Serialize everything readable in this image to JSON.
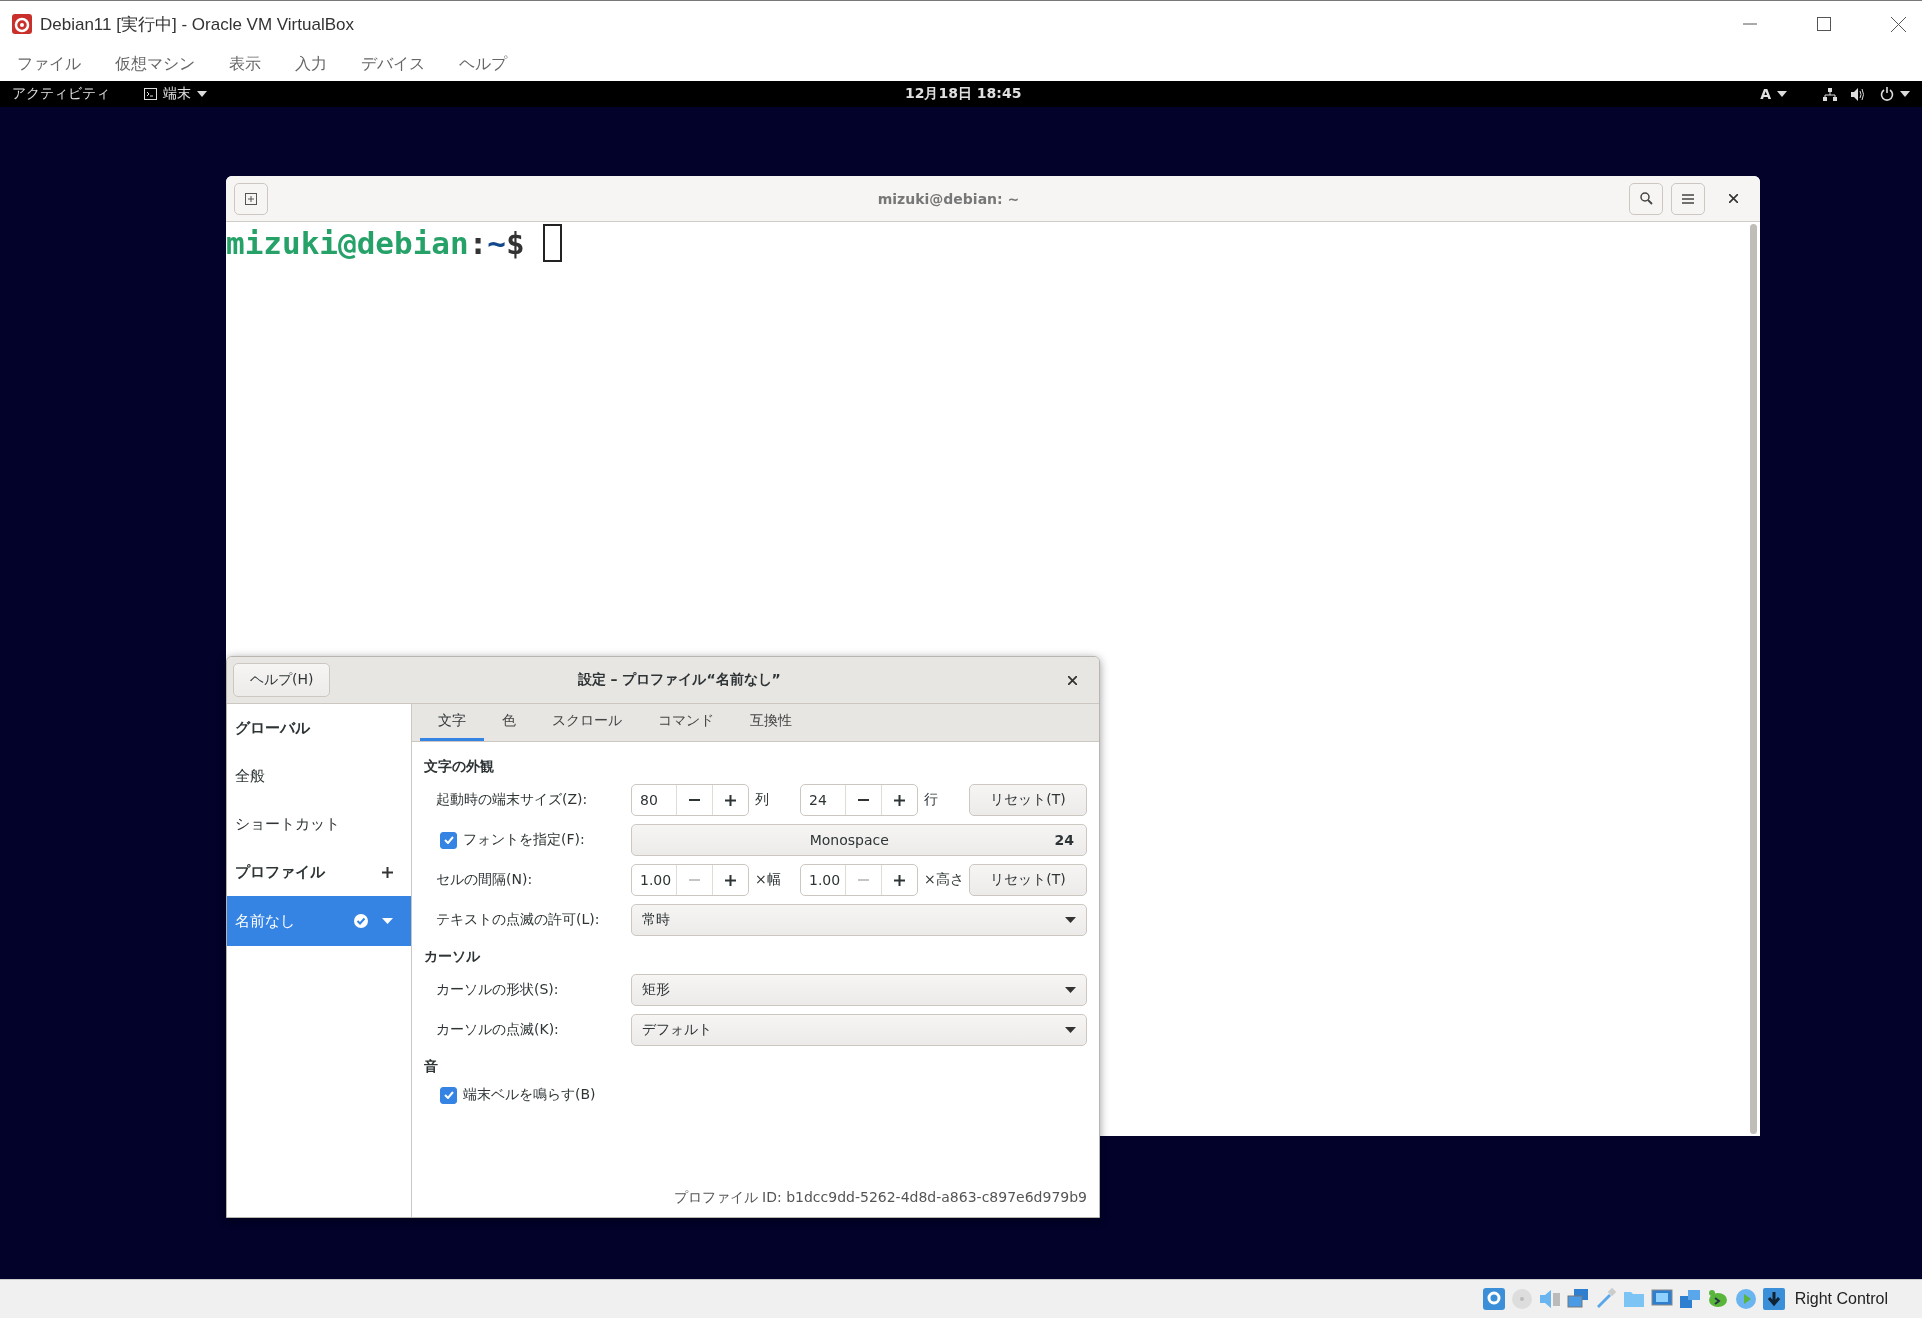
{
  "window": {
    "title": "Debian11 [実行中] - Oracle VM VirtualBox"
  },
  "menu": [
    "ファイル",
    "仮想マシン",
    "表示",
    "入力",
    "デバイス",
    "ヘルプ"
  ],
  "top_bar": {
    "activities": "アクティビティ",
    "app": "端末",
    "clock": "12月18日 18:45",
    "input_method": "A"
  },
  "terminal": {
    "title": "mizuki@debian: ~",
    "prompt_user": "mizuki@debian",
    "prompt_sep": ":",
    "prompt_path": "~",
    "prompt_symbol": "$"
  },
  "dialog": {
    "help_button": "ヘルプ(H)",
    "title": "設定 – プロファイル“名前なし”",
    "sidebar": [
      {
        "kind": "heading",
        "label": "グローバル"
      },
      {
        "kind": "item",
        "label": "全般",
        "selected": false
      },
      {
        "kind": "item",
        "label": "ショートカット",
        "selected": false
      },
      {
        "kind": "heading_add",
        "label": "プロファイル"
      },
      {
        "kind": "profile",
        "label": "名前なし",
        "selected": true
      }
    ],
    "tabs": [
      {
        "label": "文字",
        "selected": true
      },
      {
        "label": "色",
        "selected": false
      },
      {
        "label": "スクロール",
        "selected": false
      },
      {
        "label": "コマンド",
        "selected": false
      },
      {
        "label": "互換性",
        "selected": false
      }
    ],
    "text_appearance": {
      "heading": "文字の外観",
      "size": {
        "label": "起動時の端末サイズ(Z):",
        "spinners": [
          {
            "value": "80",
            "unit": "列",
            "minus_disabled": false
          },
          {
            "value": "24",
            "unit": "行",
            "minus_disabled": false
          }
        ],
        "reset": "リセット(T)"
      },
      "custom_font": {
        "label": "フォントを指定(F):",
        "checked": true,
        "font": "Monospace",
        "size": "24"
      },
      "spacing": {
        "label": "セルの間隔(N):",
        "spinners": [
          {
            "value": "1.00",
            "unit": "×幅",
            "minus_disabled": true
          },
          {
            "value": "1.00",
            "unit": "×高さ",
            "minus_disabled": true
          }
        ],
        "reset": "リセット(T)"
      },
      "blink": {
        "label": "テキストの点滅の許可(L):",
        "value": "常時"
      }
    },
    "cursor": {
      "heading": "カーソル",
      "shape": {
        "label": "カーソルの形状(S):",
        "value": "矩形"
      },
      "blink": {
        "label": "カーソルの点滅(K):",
        "value": "デフォルト"
      }
    },
    "sound": {
      "heading": "音",
      "bell": {
        "label": "端末ベルを鳴らす(B)",
        "checked": true
      }
    },
    "profile_id": "プロファイル ID: b1dcc9dd-5262-4d8d-a863-c897e6d979b9"
  },
  "status_bar": {
    "host_key": "Right Control"
  }
}
